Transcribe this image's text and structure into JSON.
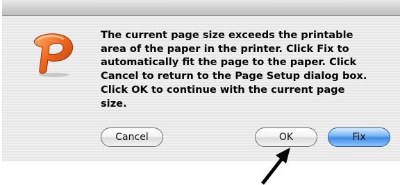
{
  "dialog": {
    "message_lines": [
      "The current page size exceeds the printable",
      "area of the paper in the printer. Click Fix to",
      "automatically fit the page to the paper. Click",
      "Cancel to return to the Page Setup dialog box.",
      "Click OK to continue with the current page",
      "size."
    ],
    "app_icon": "powerpoint-icon",
    "buttons": {
      "cancel_label": "Cancel",
      "ok_label": "OK",
      "fix_label": "Fix"
    }
  },
  "annotation": {
    "pointer": "arrow-icon"
  },
  "colors": {
    "default_button": "#3f8de3",
    "icon_orange": "#e8581a",
    "dialog_background": "#ececec"
  }
}
